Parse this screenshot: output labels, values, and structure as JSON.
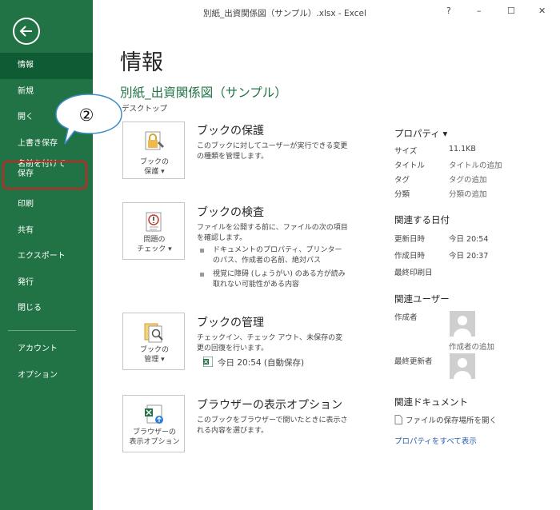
{
  "window": {
    "title": "別紙_出資関係図（サンプル）.xlsx - Excel",
    "help": "?",
    "minimize": "–",
    "maximize": "☐",
    "close": "✕"
  },
  "sidebar": {
    "items": [
      {
        "label": "情報",
        "active": true
      },
      {
        "label": "新規"
      },
      {
        "label": "開く"
      },
      {
        "label": "上書き保存"
      },
      {
        "label_line1": "名前を付けて",
        "label_line2": "保存"
      },
      {
        "label": "印刷"
      },
      {
        "label": "共有"
      },
      {
        "label": "エクスポート"
      },
      {
        "label": "発行"
      },
      {
        "label": "閉じる"
      }
    ],
    "bottom": [
      {
        "label": "アカウント"
      },
      {
        "label": "オプション"
      }
    ]
  },
  "callout": {
    "number": "②"
  },
  "main": {
    "title": "情報",
    "doc_name": "別紙_出資関係図（サンプル）",
    "location": "デスクトップ",
    "sections": {
      "protect": {
        "button_line1": "ブックの",
        "button_line2": "保護 ▾",
        "title": "ブックの保護",
        "desc": "このブックに対してユーザーが実行できる変更の種類を管理します。"
      },
      "inspect": {
        "button_line1": "問題の",
        "button_line2": "チェック ▾",
        "title": "ブックの検査",
        "desc": "ファイルを公開する前に、ファイルの次の項目を確認します。",
        "bullets": [
          "ドキュメントのプロパティ、プリンターのパス、作成者の名前、絶対パス",
          "視覚に障碍 (しょうがい) のある方が読み取れない可能性がある内容"
        ]
      },
      "manage": {
        "button_line1": "ブックの",
        "button_line2": "管理 ▾",
        "title": "ブックの管理",
        "desc": "チェックイン、チェック アウト、未保存の変更の回復を行います。",
        "autosave": "今日 20:54 (自動保存)"
      },
      "browser": {
        "button_line1": "ブラウザーの",
        "button_line2": "表示オプション",
        "title": "ブラウザーの表示オプション",
        "desc": "このブックをブラウザーで開いたときに表示される内容を選びます。"
      }
    }
  },
  "properties": {
    "header": "プロパティ ▾",
    "rows": [
      {
        "label": "サイズ",
        "value": "11.1KB"
      },
      {
        "label": "タイトル",
        "value": "タイトルの追加"
      },
      {
        "label": "タグ",
        "value": "タグの追加"
      },
      {
        "label": "分類",
        "value": "分類の追加"
      }
    ],
    "dates_header": "関連する日付",
    "dates": [
      {
        "label": "更新日時",
        "value": "今日 20:54"
      },
      {
        "label": "作成日時",
        "value": "今日 20:37"
      },
      {
        "label": "最終印刷日",
        "value": ""
      }
    ],
    "users_header": "関連ユーザー",
    "author_label": "作成者",
    "add_author": "作成者の追加",
    "last_modified_label": "最終更新者",
    "docs_header": "関連ドキュメント",
    "open_location": "ファイルの保存場所を開く",
    "show_all": "プロパティをすべて表示"
  },
  "colors": {
    "sidebar": "#217346",
    "accent_green": "#217346",
    "link": "#2a5eb0",
    "highlight_red": "#d62020"
  }
}
